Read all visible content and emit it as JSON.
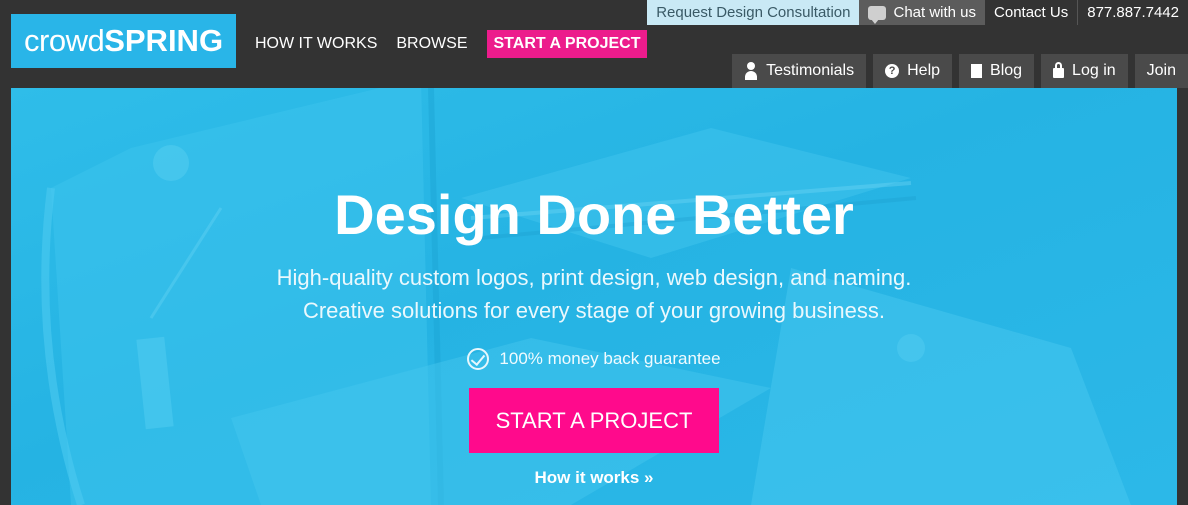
{
  "logo": {
    "light": "crowd",
    "bold": "SPRING"
  },
  "main_nav": {
    "how_it_works": "HOW IT WORKS",
    "browse": "BROWSE",
    "start_project": "START A PROJECT"
  },
  "util_bar": {
    "consultation": "Request Design Consultation",
    "chat": "Chat with us",
    "contact": "Contact Us",
    "phone": "877.887.7442"
  },
  "sub_nav": {
    "testimonials": "Testimonials",
    "help": "Help",
    "blog": "Blog",
    "login": "Log in",
    "join": "Join"
  },
  "hero": {
    "headline": "Design Done Better",
    "subtitle_line1": "High-quality custom logos, print design, web design, and naming.",
    "subtitle_line2": "Creative solutions for every stage of your growing business.",
    "guarantee": "100% money back guarantee",
    "cta": "START A PROJECT",
    "how_link": "How it works »"
  },
  "colors": {
    "topbar": "#333333",
    "brand_blue": "#29b5e8",
    "accent_pink": "#ec1c8c",
    "hero_cta": "#ff0a8c",
    "hero_overlay": "#2cb8e8"
  },
  "icons": {
    "chat": "chat-bubble-icon",
    "testimonials": "person-icon",
    "help": "question-circle-icon",
    "blog": "document-icon",
    "login": "lock-icon",
    "guarantee": "check-circle-icon"
  }
}
